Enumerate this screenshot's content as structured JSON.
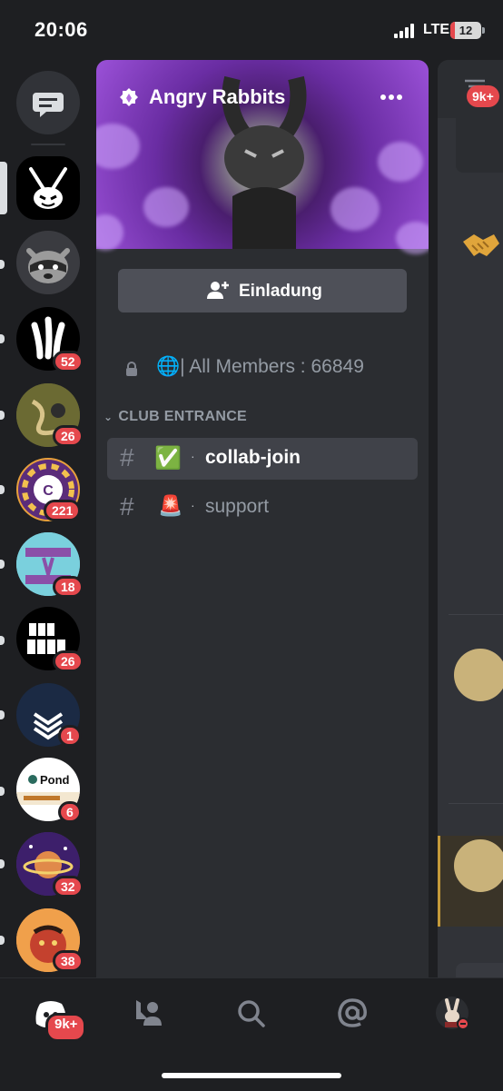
{
  "status_bar": {
    "time": "20:06",
    "network": "LTE",
    "battery": "12"
  },
  "server": {
    "name": "Angry Rabbits"
  },
  "invite": {
    "label": "Einladung"
  },
  "members_channel": {
    "label": "🌐| All Members : 66849"
  },
  "category": {
    "label": "CLUB ENTRANCE"
  },
  "channels": [
    {
      "emoji": "✅",
      "label": "collab-join"
    },
    {
      "emoji": "🚨",
      "label": "support"
    }
  ],
  "server_badges": [
    "52",
    "26",
    "221",
    "18",
    "26",
    "1",
    "6",
    "32",
    "38"
  ],
  "servers": {
    "pond_label": "Pond"
  },
  "chat_badge": "9k+",
  "nav_badge": "9k+",
  "colors": {
    "accent_red": "#e5484d",
    "selected": "#404249",
    "panel": "#2b2d31"
  }
}
